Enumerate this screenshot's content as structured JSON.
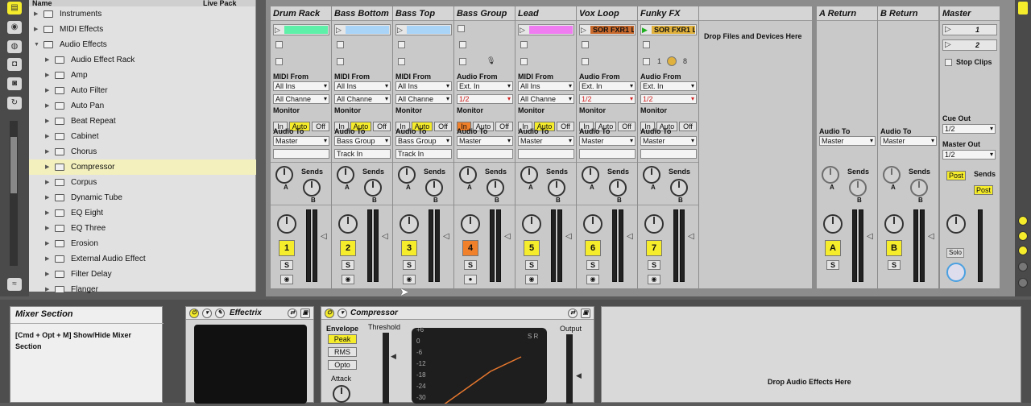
{
  "browser": {
    "header_name": "Name",
    "header_pack": "Live Pack",
    "items": [
      {
        "label": "Instruments",
        "level": 0,
        "open": false,
        "selected": false
      },
      {
        "label": "MIDI Effects",
        "level": 0,
        "open": false,
        "selected": false
      },
      {
        "label": "Audio Effects",
        "level": 0,
        "open": true,
        "selected": false
      },
      {
        "label": "Audio Effect Rack",
        "level": 1,
        "open": false,
        "selected": false
      },
      {
        "label": "Amp",
        "level": 1,
        "open": false,
        "selected": false
      },
      {
        "label": "Auto Filter",
        "level": 1,
        "open": false,
        "selected": false
      },
      {
        "label": "Auto Pan",
        "level": 1,
        "open": false,
        "selected": false
      },
      {
        "label": "Beat Repeat",
        "level": 1,
        "open": false,
        "selected": false
      },
      {
        "label": "Cabinet",
        "level": 1,
        "open": false,
        "selected": false
      },
      {
        "label": "Chorus",
        "level": 1,
        "open": false,
        "selected": false
      },
      {
        "label": "Compressor",
        "level": 1,
        "open": false,
        "selected": true
      },
      {
        "label": "Corpus",
        "level": 1,
        "open": false,
        "selected": false
      },
      {
        "label": "Dynamic Tube",
        "level": 1,
        "open": false,
        "selected": false
      },
      {
        "label": "EQ Eight",
        "level": 1,
        "open": false,
        "selected": false
      },
      {
        "label": "EQ Three",
        "level": 1,
        "open": false,
        "selected": false
      },
      {
        "label": "Erosion",
        "level": 1,
        "open": false,
        "selected": false
      },
      {
        "label": "External Audio Effect",
        "level": 1,
        "open": false,
        "selected": false
      },
      {
        "label": "Filter Delay",
        "level": 1,
        "open": false,
        "selected": false
      },
      {
        "label": "Flanger",
        "level": 1,
        "open": false,
        "selected": false
      }
    ]
  },
  "tracks": [
    {
      "name": "Drum Rack",
      "clip_color": "#5ef0a8",
      "clip_text": "",
      "from_label": "MIDI From",
      "from": "All Ins",
      "channel": "All Channe",
      "monitor_active": "Auto",
      "audio_to": "Master",
      "track_in": "",
      "number": "1",
      "number_color": "#f5ec2c"
    },
    {
      "name": "Bass Bottom",
      "clip_color": "#a9d3f7",
      "clip_text": "",
      "from_label": "MIDI From",
      "from": "All Ins",
      "channel": "All Channe",
      "monitor_active": "Auto",
      "audio_to": "Bass Group",
      "track_in": "Track In",
      "number": "2",
      "number_color": "#f5ec2c"
    },
    {
      "name": "Bass Top",
      "clip_color": "#a9d3f7",
      "clip_text": "",
      "from_label": "MIDI From",
      "from": "All Ins",
      "channel": "All Channe",
      "monitor_active": "Auto",
      "audio_to": "Bass Group",
      "track_in": "Track In",
      "number": "3",
      "number_color": "#f5ec2c"
    },
    {
      "name": "Bass Group",
      "clip_color": "",
      "clip_text": "",
      "from_label": "Audio From",
      "from": "Ext. In",
      "channel": "1/2",
      "monitor_active": "In",
      "audio_to": "Master",
      "track_in": "",
      "number": "4",
      "number_color": "#f0802a"
    },
    {
      "name": "Lead",
      "clip_color": "#ef7cf0",
      "clip_text": "",
      "from_label": "MIDI From",
      "from": "All Ins",
      "channel": "All Channe",
      "monitor_active": "Auto",
      "audio_to": "Master",
      "track_in": "",
      "number": "5",
      "number_color": "#f5ec2c"
    },
    {
      "name": "Vox Loop",
      "clip_color": "#c96a2e",
      "clip_text": "SOR FXR1 L",
      "from_label": "Audio From",
      "from": "Ext. In",
      "channel": "1/2",
      "monitor_active": "",
      "audio_to": "Master",
      "track_in": "",
      "number": "6",
      "number_color": "#f5ec2c"
    },
    {
      "name": "Funky FX",
      "clip_color": "#e0b13c",
      "clip_text": "SOR FXR1 L",
      "from_label": "Audio From",
      "from": "Ext. In",
      "channel": "1/2",
      "monitor_active": "",
      "audio_to": "Master",
      "track_in": "",
      "number": "7",
      "number_color": "#f5ec2c"
    }
  ],
  "funky_extra": {
    "a": "1",
    "b": "8"
  },
  "monitor_labels": {
    "title": "Monitor",
    "in": "In",
    "auto": "Auto",
    "off": "Off"
  },
  "audio_to_label": "Audio To",
  "sends_label": "Sends",
  "knob_a": "A",
  "knob_b": "B",
  "solo_label": "S",
  "drop_files": "Drop Files and Devices Here",
  "returns": [
    {
      "name": "A Return",
      "audio_to": "Master",
      "letter": "A"
    },
    {
      "name": "B Return",
      "audio_to": "Master",
      "letter": "B"
    }
  ],
  "master": {
    "name": "Master",
    "scene1": "1",
    "scene2": "2",
    "stop_clips": "Stop Clips",
    "cue_out_label": "Cue Out",
    "cue_out": "1/2",
    "master_out_label": "Master Out",
    "master_out": "1/2",
    "post1": "Post",
    "post2": "Post",
    "solo": "Solo"
  },
  "info": {
    "title": "Mixer Section",
    "text": "[Cmd + Opt + M] Show/Hide Mixer Section"
  },
  "effectrix": {
    "title": "Effectrix"
  },
  "compressor": {
    "title": "Compressor",
    "envelope": "Envelope",
    "peak": "Peak",
    "rms": "RMS",
    "opto": "Opto",
    "attack": "Attack",
    "threshold": "Threshold",
    "output": "Output",
    "sr": "S R",
    "scale": [
      "+6",
      "0",
      "-6",
      "-12",
      "-18",
      "-24",
      "-30"
    ]
  },
  "drop_audio": "Drop Audio Effects Here",
  "right_strip": [
    "I·O",
    "S",
    "R",
    "M",
    "D",
    "X"
  ],
  "colors": {
    "accent_yellow": "#f5ec2c",
    "accent_orange": "#f0802a",
    "selection": "#f3f0bd"
  }
}
